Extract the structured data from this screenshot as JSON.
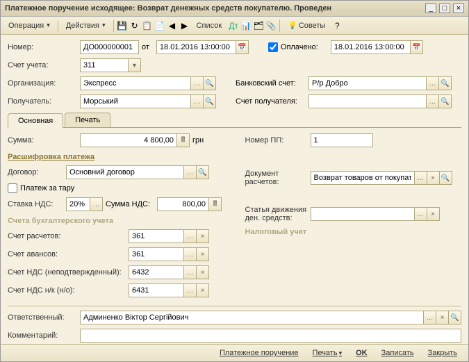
{
  "title": "Платежное поручение исходящее: Возврат денежных средств покупателю. Проведен",
  "toolbar": {
    "operation": "Операция",
    "actions": "Действия",
    "list": "Список",
    "advice": "Советы"
  },
  "header": {
    "number_lbl": "Номер:",
    "number": "ДО000000001",
    "from": "от",
    "date1": "18.01.2016 13:00:00",
    "paid_lbl": "Оплачено:",
    "date2": "18.01.2016 13:00:00",
    "account_lbl": "Счет учета:",
    "account": "311",
    "org_lbl": "Организация:",
    "org": "Экспресс",
    "bank_lbl": "Банковский счет:",
    "bank": "Р/р Добро",
    "recipient_lbl": "Получатель:",
    "recipient": "Морський",
    "recip_acc_lbl": "Счет получателя:"
  },
  "tabs": {
    "main": "Основная",
    "print": "Печать"
  },
  "main": {
    "sum_lbl": "Сумма:",
    "sum": "4 800,00",
    "currency": "грн",
    "pp_lbl": "Номер ПП:",
    "pp": "1",
    "decode_title": "Расшифровка платежа",
    "contract_lbl": "Договор:",
    "contract": "Основний договор",
    "doc_lbl": "Документ расчетов:",
    "doc": "Возврат товаров от покупателя",
    "tare_lbl": "Платеж за тару",
    "vat_rate_lbl": "Ставка НДС:",
    "vat_rate": "20%",
    "vat_sum_lbl": "Сумма НДС:",
    "vat_sum": "800,00",
    "flow_lbl": "Статья движения ден. средств:",
    "tax_title": "Налоговый учет",
    "acc_title": "Счета бухгалтерского учета",
    "acc_calc_lbl": "Счет расчетов:",
    "acc_calc": "361",
    "acc_adv_lbl": "Счет авансов:",
    "acc_adv": "361",
    "acc_vat1_lbl": "Счет НДС (неподтвержденный):",
    "acc_vat1": "6432",
    "acc_vat2_lbl": "Счет НДС н/к (н/о):",
    "acc_vat2": "6431"
  },
  "bottom": {
    "resp_lbl": "Ответственный:",
    "resp": "Админенко Віктор Сергійович",
    "comment_lbl": "Комментарий:"
  },
  "footer": {
    "payorder": "Платежное поручение",
    "print": "Печать",
    "ok": "OK",
    "save": "Записать",
    "close": "Закрыть"
  }
}
